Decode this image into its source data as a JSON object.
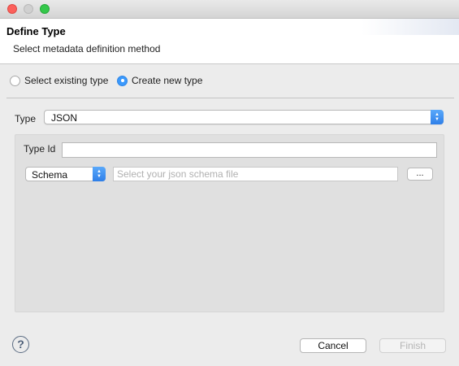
{
  "window": {
    "controls": [
      "close",
      "minimize",
      "maximize"
    ]
  },
  "header": {
    "title": "Define Type",
    "subtitle": "Select metadata definition method"
  },
  "method": {
    "options": [
      {
        "label": "Select existing type",
        "checked": false
      },
      {
        "label": "Create new type",
        "checked": true
      }
    ]
  },
  "type_row": {
    "label": "Type",
    "selected": "JSON"
  },
  "details": {
    "type_id_label": "Type Id",
    "type_id_value": "",
    "source_selected": "Schema",
    "schema_placeholder": "Select your json schema file",
    "browse_label": "..."
  },
  "footer": {
    "help_icon": "?",
    "cancel_label": "Cancel",
    "finish_label": "Finish"
  },
  "colors": {
    "accent": "#3b99fc",
    "close": "#fc605b",
    "maximize": "#34c84a"
  }
}
